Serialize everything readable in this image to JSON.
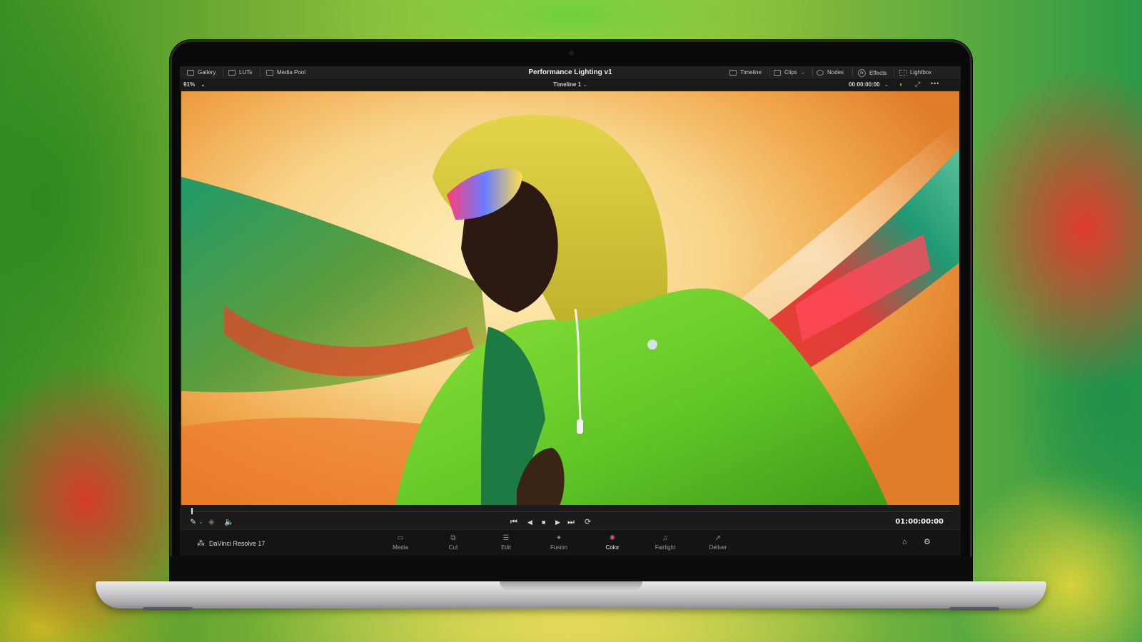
{
  "app": {
    "project_title": "Performance Lighting v1",
    "brand_name": "DaVinci Resolve 17"
  },
  "topbar": {
    "left": [
      {
        "label": "Gallery",
        "icon": "gallery-icon"
      },
      {
        "label": "LUTs",
        "icon": "luts-icon"
      },
      {
        "label": "Media Pool",
        "icon": "media-pool-icon"
      }
    ],
    "right": [
      {
        "label": "Timeline",
        "icon": "timeline-icon"
      },
      {
        "label": "Clips",
        "icon": "clips-icon"
      },
      {
        "label": "Nodes",
        "icon": "nodes-icon"
      },
      {
        "label": "Effects",
        "icon": "fx-icon"
      },
      {
        "label": "Lightbox",
        "icon": "lightbox-icon"
      }
    ]
  },
  "subbar": {
    "zoom": "91%",
    "timeline_name": "Timeline 1",
    "source_timecode": "00:00:00:00"
  },
  "transport": {
    "timecode": "01:00:00:00"
  },
  "pages": [
    {
      "label": "Media",
      "icon": "media-page-icon",
      "active": false
    },
    {
      "label": "Cut",
      "icon": "cut-page-icon",
      "active": false
    },
    {
      "label": "Edit",
      "icon": "edit-page-icon",
      "active": false
    },
    {
      "label": "Fusion",
      "icon": "fusion-page-icon",
      "active": false
    },
    {
      "label": "Color",
      "icon": "color-page-icon",
      "active": true
    },
    {
      "label": "Fairlight",
      "icon": "fairlight-page-icon",
      "active": false
    },
    {
      "label": "Deliver",
      "icon": "deliver-page-icon",
      "active": false
    }
  ],
  "colors": {
    "active_page_accent": "#e33b46",
    "raincoat_green": "#6fd12a",
    "hood_yellow": "#d9d23a",
    "backdrop_orange": "#f0a64a"
  }
}
